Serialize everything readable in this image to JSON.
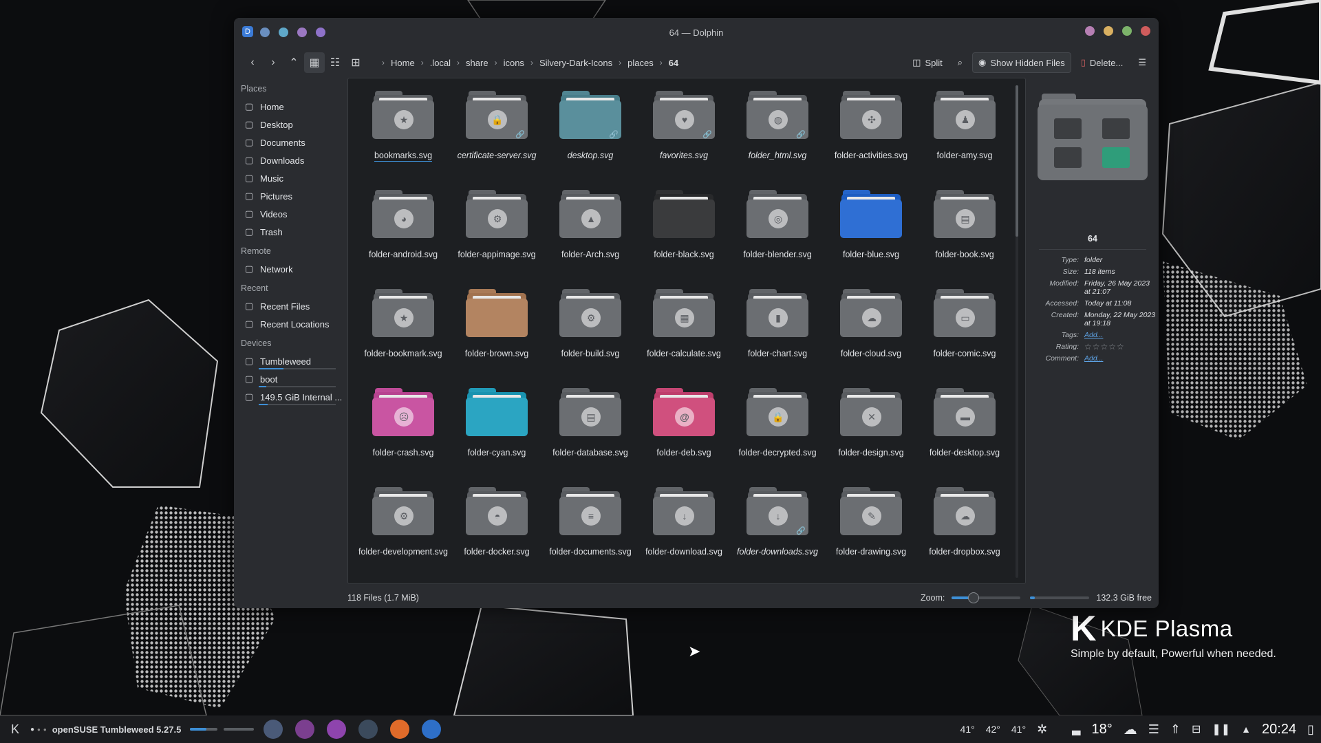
{
  "window": {
    "title": "64 — Dolphin",
    "title_dots_left": [
      "#6a8fbf",
      "#5fa8c9",
      "#9b78c2",
      "#8e72c9"
    ],
    "title_dots_right": [
      "#b67fb3",
      "#d9b061",
      "#7cb36a",
      "#cf5c5c"
    ]
  },
  "toolbar": {
    "back_icon": "chevron-left-icon",
    "forward_icon": "chevron-right-icon",
    "up_icon": "chevron-up-icon",
    "breadcrumbs": [
      "Home",
      ".local",
      "share",
      "icons",
      "Silvery-Dark-Icons",
      "places",
      "64"
    ],
    "split_label": "Split",
    "show_hidden_label": "Show Hidden Files",
    "delete_label": "Delete..."
  },
  "sidebar": {
    "places_heading": "Places",
    "places": [
      {
        "label": "Home",
        "icon": "home-icon"
      },
      {
        "label": "Desktop",
        "icon": "desktop-icon"
      },
      {
        "label": "Documents",
        "icon": "documents-icon"
      },
      {
        "label": "Downloads",
        "icon": "downloads-icon"
      },
      {
        "label": "Music",
        "icon": "music-icon"
      },
      {
        "label": "Pictures",
        "icon": "pictures-icon"
      },
      {
        "label": "Videos",
        "icon": "videos-icon"
      },
      {
        "label": "Trash",
        "icon": "trash-icon"
      }
    ],
    "remote_heading": "Remote",
    "remote": [
      {
        "label": "Network",
        "icon": "network-icon"
      }
    ],
    "recent_heading": "Recent",
    "recent": [
      {
        "label": "Recent Files",
        "icon": "recent-files-icon"
      },
      {
        "label": "Recent Locations",
        "icon": "recent-locations-icon"
      }
    ],
    "devices_heading": "Devices",
    "devices": [
      {
        "label": "Tumbleweed",
        "icon": "drive-icon",
        "used": 0.32
      },
      {
        "label": "boot",
        "icon": "drive-icon",
        "used": 0.1
      },
      {
        "label": "149.5 GiB Internal ...",
        "icon": "drive-icon",
        "used": 0.12
      }
    ]
  },
  "files": [
    {
      "name": "bookmarks.svg",
      "color": "#6b6e72",
      "emblem": "★",
      "link": false,
      "italic": false
    },
    {
      "name": "certificate-server.svg",
      "color": "#6b6e72",
      "emblem": "🔒",
      "link": true,
      "italic": true
    },
    {
      "name": "desktop.svg",
      "color": "#5a8f9c",
      "emblem": "",
      "link": true,
      "italic": true
    },
    {
      "name": "favorites.svg",
      "color": "#6b6e72",
      "emblem": "♥",
      "link": true,
      "italic": true
    },
    {
      "name": "folder_html.svg",
      "color": "#6b6e72",
      "emblem": "◍",
      "link": true,
      "italic": true
    },
    {
      "name": "folder-activities.svg",
      "color": "#6b6e72",
      "emblem": "✣",
      "link": false,
      "italic": false
    },
    {
      "name": "folder-amy.svg",
      "color": "#6b6e72",
      "emblem": "♟",
      "link": false,
      "italic": false
    },
    {
      "name": "folder-android.svg",
      "color": "#6b6e72",
      "emblem": "◕",
      "link": false,
      "italic": false
    },
    {
      "name": "folder-appimage.svg",
      "color": "#6b6e72",
      "emblem": "⚙",
      "link": false,
      "italic": false
    },
    {
      "name": "folder-Arch.svg",
      "color": "#6b6e72",
      "emblem": "▲",
      "link": false,
      "italic": false
    },
    {
      "name": "folder-black.svg",
      "color": "#3a3b3d",
      "emblem": "",
      "link": false,
      "italic": false
    },
    {
      "name": "folder-blender.svg",
      "color": "#6b6e72",
      "emblem": "◎",
      "link": false,
      "italic": false
    },
    {
      "name": "folder-blue.svg",
      "color": "#2f6fd4",
      "emblem": "",
      "link": false,
      "italic": false
    },
    {
      "name": "folder-book.svg",
      "color": "#6b6e72",
      "emblem": "▤",
      "link": false,
      "italic": false
    },
    {
      "name": "folder-bookmark.svg",
      "color": "#6b6e72",
      "emblem": "★",
      "link": false,
      "italic": false
    },
    {
      "name": "folder-brown.svg",
      "color": "#b38461",
      "emblem": "",
      "link": false,
      "italic": false
    },
    {
      "name": "folder-build.svg",
      "color": "#6b6e72",
      "emblem": "⚙",
      "link": false,
      "italic": false
    },
    {
      "name": "folder-calculate.svg",
      "color": "#6b6e72",
      "emblem": "▦",
      "link": false,
      "italic": false
    },
    {
      "name": "folder-chart.svg",
      "color": "#6b6e72",
      "emblem": "▮",
      "link": false,
      "italic": false
    },
    {
      "name": "folder-cloud.svg",
      "color": "#6b6e72",
      "emblem": "☁",
      "link": false,
      "italic": false
    },
    {
      "name": "folder-comic.svg",
      "color": "#6b6e72",
      "emblem": "▭",
      "link": false,
      "italic": false
    },
    {
      "name": "folder-crash.svg",
      "color": "#c955a2",
      "emblem": "☹",
      "link": false,
      "italic": false
    },
    {
      "name": "folder-cyan.svg",
      "color": "#2ba5c2",
      "emblem": "",
      "link": false,
      "italic": false
    },
    {
      "name": "folder-database.svg",
      "color": "#6b6e72",
      "emblem": "▤",
      "link": false,
      "italic": false
    },
    {
      "name": "folder-deb.svg",
      "color": "#d0507e",
      "emblem": "@",
      "link": false,
      "italic": false
    },
    {
      "name": "folder-decrypted.svg",
      "color": "#6b6e72",
      "emblem": "🔒",
      "link": false,
      "italic": false
    },
    {
      "name": "folder-design.svg",
      "color": "#6b6e72",
      "emblem": "✕",
      "link": false,
      "italic": false
    },
    {
      "name": "folder-desktop.svg",
      "color": "#6b6e72",
      "emblem": "▬",
      "link": false,
      "italic": false
    },
    {
      "name": "folder-development.svg",
      "color": "#6b6e72",
      "emblem": "⚙",
      "link": false,
      "italic": false
    },
    {
      "name": "folder-docker.svg",
      "color": "#6b6e72",
      "emblem": "◓",
      "link": false,
      "italic": false
    },
    {
      "name": "folder-documents.svg",
      "color": "#6b6e72",
      "emblem": "≡",
      "link": false,
      "italic": false
    },
    {
      "name": "folder-download.svg",
      "color": "#6b6e72",
      "emblem": "↓",
      "link": false,
      "italic": false
    },
    {
      "name": "folder-downloads.svg",
      "color": "#6b6e72",
      "emblem": "↓",
      "link": true,
      "italic": true
    },
    {
      "name": "folder-drawing.svg",
      "color": "#6b6e72",
      "emblem": "✎",
      "link": false,
      "italic": false
    },
    {
      "name": "folder-dropbox.svg",
      "color": "#6b6e72",
      "emblem": "☁",
      "link": false,
      "italic": false
    }
  ],
  "info_panel": {
    "name": "64",
    "type_label": "Type:",
    "type": "folder",
    "size_label": "Size:",
    "size": "118 items",
    "modified_label": "Modified:",
    "modified": "Friday, 26 May 2023 at 21:07",
    "accessed_label": "Accessed:",
    "accessed": "Today at 11:08",
    "created_label": "Created:",
    "created": "Monday, 22 May 2023 at 19:18",
    "tags_label": "Tags:",
    "tags": "Add...",
    "rating_label": "Rating:",
    "rating": "☆☆☆☆☆",
    "comment_label": "Comment:",
    "comment": "Add..."
  },
  "statusbar": {
    "files": "118 Files (1.7 MiB)",
    "zoom_label": "Zoom:",
    "zoom_value": 0.32,
    "free": "132.3 GiB free",
    "disk_used": 0.08
  },
  "panel": {
    "activity": "openSUSE Tumbleweed 5.27.5",
    "temps": [
      "41°",
      "42°",
      "41°"
    ],
    "weather": "18°",
    "clock": "20:24",
    "apps": [
      {
        "name": "files-app-icon",
        "color": "#4a5a78"
      },
      {
        "name": "browser-app-icon",
        "color": "#7b3f8f"
      },
      {
        "name": "shop-app-icon",
        "color": "#8e44ad"
      },
      {
        "name": "settings-app-icon",
        "color": "#3b4a5c"
      },
      {
        "name": "firefox-app-icon",
        "color": "#e06b2a"
      },
      {
        "name": "dolphin-app-icon",
        "color": "#2e6fc8"
      }
    ]
  },
  "desktop": {
    "brand_name": "KDE Plasma",
    "brand_tagline": "Simple by default, Powerful when  needed."
  }
}
